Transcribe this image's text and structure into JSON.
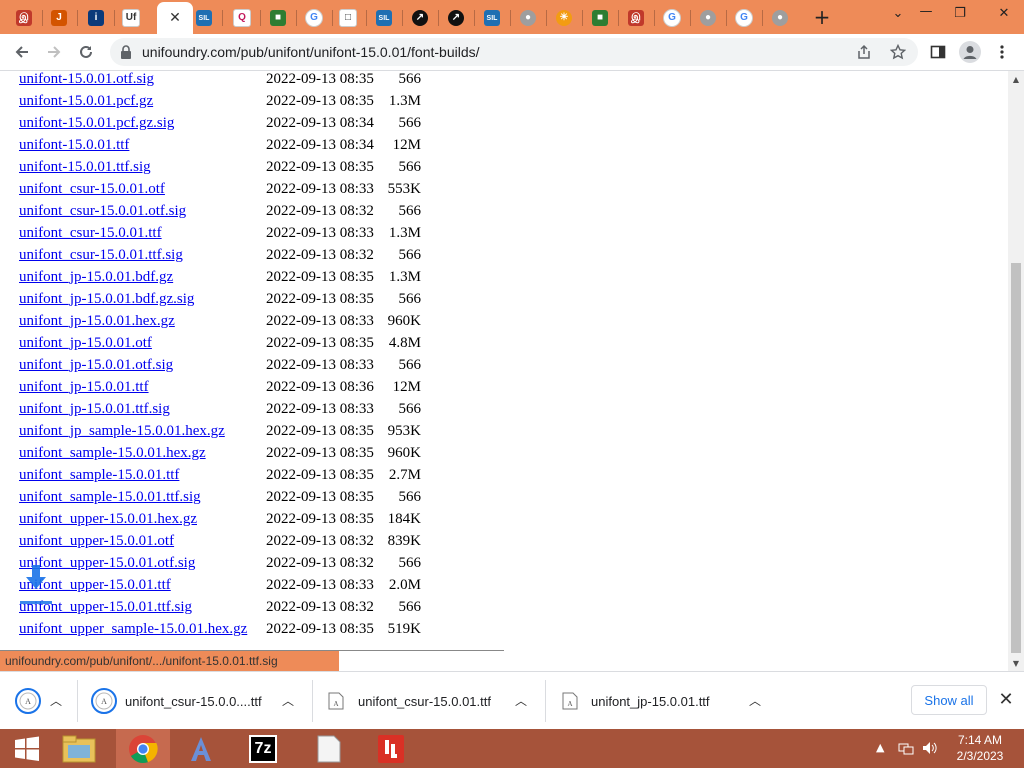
{
  "browser": {
    "tabs": [
      {
        "icon": "unicode-logo-icon",
        "bg": "#c0392b",
        "glyph": "இ"
      },
      {
        "icon": "pdf-doc-icon",
        "bg": "#d35400",
        "glyph": "J"
      },
      {
        "icon": "info-icon",
        "bg": "#0b3a7a",
        "glyph": "i"
      },
      {
        "icon": "unifoundry-logo-icon",
        "bg": "#ffffff",
        "glyph": "Uf"
      },
      {
        "icon": "close-icon",
        "active": true
      },
      {
        "icon": "sil-logo-icon",
        "bg": "#1f6fb2",
        "glyph": "SIL"
      },
      {
        "icon": "q-logo-icon",
        "bg": "#ffffff",
        "glyph": "Q"
      },
      {
        "icon": "colorful-logo-icon",
        "bg": "#2e7d32",
        "glyph": "■"
      },
      {
        "icon": "google-icon",
        "bg": "#ffffff",
        "glyph": "G"
      },
      {
        "icon": "document-icon",
        "bg": "#ffffff",
        "glyph": "□"
      },
      {
        "icon": "sil-logo-icon",
        "bg": "#1f6fb2",
        "glyph": "SIL"
      },
      {
        "icon": "dark-circle-icon",
        "bg": "#111111",
        "glyph": "↗"
      },
      {
        "icon": "dark-circle-icon",
        "bg": "#111111",
        "glyph": "↗"
      },
      {
        "icon": "sil-logo-icon",
        "bg": "#1f6fb2",
        "glyph": "SIL"
      },
      {
        "icon": "globe-icon",
        "bg": "#9e9e9e",
        "glyph": "●"
      },
      {
        "icon": "sun-logo-icon",
        "bg": "#f39c12",
        "glyph": "☀"
      },
      {
        "icon": "colorful-logo-icon",
        "bg": "#2e7d32",
        "glyph": "■"
      },
      {
        "icon": "unicode-logo-icon",
        "bg": "#c0392b",
        "glyph": "இ"
      },
      {
        "icon": "google-icon",
        "bg": "#ffffff",
        "glyph": "G"
      },
      {
        "icon": "globe-icon",
        "bg": "#9e9e9e",
        "glyph": "●"
      },
      {
        "icon": "google-icon",
        "bg": "#ffffff",
        "glyph": "G"
      },
      {
        "icon": "globe-icon",
        "bg": "#9e9e9e",
        "glyph": "●"
      }
    ],
    "new_tab_glyph": "+",
    "url": "unifoundry.com/pub/unifont/unifont-15.0.01/font-builds/",
    "status_url": "unifoundry.com/pub/unifont/.../unifont-15.0.01.ttf.sig",
    "theme_color": "#ee8b58"
  },
  "listing": [
    {
      "name": "unifont-15.0.01.otf.sig",
      "date": "2022-09-13 08:35",
      "size": "566"
    },
    {
      "name": "unifont-15.0.01.pcf.gz",
      "date": "2022-09-13 08:35",
      "size": "1.3M"
    },
    {
      "name": "unifont-15.0.01.pcf.gz.sig",
      "date": "2022-09-13 08:34",
      "size": "566"
    },
    {
      "name": "unifont-15.0.01.ttf",
      "date": "2022-09-13 08:34",
      "size": "12M"
    },
    {
      "name": "unifont-15.0.01.ttf.sig",
      "date": "2022-09-13 08:35",
      "size": "566"
    },
    {
      "name": "unifont_csur-15.0.01.otf",
      "date": "2022-09-13 08:33",
      "size": "553K"
    },
    {
      "name": "unifont_csur-15.0.01.otf.sig",
      "date": "2022-09-13 08:32",
      "size": "566"
    },
    {
      "name": "unifont_csur-15.0.01.ttf",
      "date": "2022-09-13 08:33",
      "size": "1.3M"
    },
    {
      "name": "unifont_csur-15.0.01.ttf.sig",
      "date": "2022-09-13 08:32",
      "size": "566"
    },
    {
      "name": "unifont_jp-15.0.01.bdf.gz",
      "date": "2022-09-13 08:35",
      "size": "1.3M"
    },
    {
      "name": "unifont_jp-15.0.01.bdf.gz.sig",
      "date": "2022-09-13 08:35",
      "size": "566"
    },
    {
      "name": "unifont_jp-15.0.01.hex.gz",
      "date": "2022-09-13 08:33",
      "size": "960K"
    },
    {
      "name": "unifont_jp-15.0.01.otf",
      "date": "2022-09-13 08:35",
      "size": "4.8M"
    },
    {
      "name": "unifont_jp-15.0.01.otf.sig",
      "date": "2022-09-13 08:33",
      "size": "566"
    },
    {
      "name": "unifont_jp-15.0.01.ttf",
      "date": "2022-09-13 08:36",
      "size": "12M"
    },
    {
      "name": "unifont_jp-15.0.01.ttf.sig",
      "date": "2022-09-13 08:33",
      "size": "566"
    },
    {
      "name": "unifont_jp_sample-15.0.01.hex.gz",
      "date": "2022-09-13 08:35",
      "size": "953K"
    },
    {
      "name": "unifont_sample-15.0.01.hex.gz",
      "date": "2022-09-13 08:35",
      "size": "960K"
    },
    {
      "name": "unifont_sample-15.0.01.ttf",
      "date": "2022-09-13 08:35",
      "size": "2.7M"
    },
    {
      "name": "unifont_sample-15.0.01.ttf.sig",
      "date": "2022-09-13 08:35",
      "size": "566"
    },
    {
      "name": "unifont_upper-15.0.01.hex.gz",
      "date": "2022-09-13 08:35",
      "size": "184K"
    },
    {
      "name": "unifont_upper-15.0.01.otf",
      "date": "2022-09-13 08:32",
      "size": "839K"
    },
    {
      "name": "unifont_upper-15.0.01.otf.sig",
      "date": "2022-09-13 08:32",
      "size": "566"
    },
    {
      "name": "unifont_upper-15.0.01.ttf",
      "date": "2022-09-13 08:33",
      "size": "2.0M"
    },
    {
      "name": "unifont_upper-15.0.01.ttf.sig",
      "date": "2022-09-13 08:32",
      "size": "566"
    },
    {
      "name": "unifont_upper_sample-15.0.01.hex.gz",
      "date": "2022-09-13 08:35",
      "size": "519K"
    }
  ],
  "downloads": {
    "items": [
      {
        "name": "",
        "icon": "download-progress-icon"
      },
      {
        "name": "unifont_csur-15.0.0....ttf",
        "icon": "download-progress-icon"
      },
      {
        "name": "unifont_csur-15.0.01.ttf",
        "icon": "font-file-icon"
      },
      {
        "name": "unifont_jp-15.0.01.ttf",
        "icon": "font-file-icon"
      }
    ],
    "show_all_label": "Show all"
  },
  "taskbar": {
    "time": "7:14 AM",
    "date": "2/3/2023",
    "apps": [
      {
        "icon": "windows-start-icon"
      },
      {
        "icon": "file-explorer-icon"
      },
      {
        "icon": "chrome-icon",
        "active": true
      },
      {
        "icon": "font-app-icon"
      },
      {
        "icon": "7zip-icon",
        "glyph": "7z"
      },
      {
        "icon": "notepad-icon"
      },
      {
        "icon": "red-app-icon"
      }
    ]
  }
}
